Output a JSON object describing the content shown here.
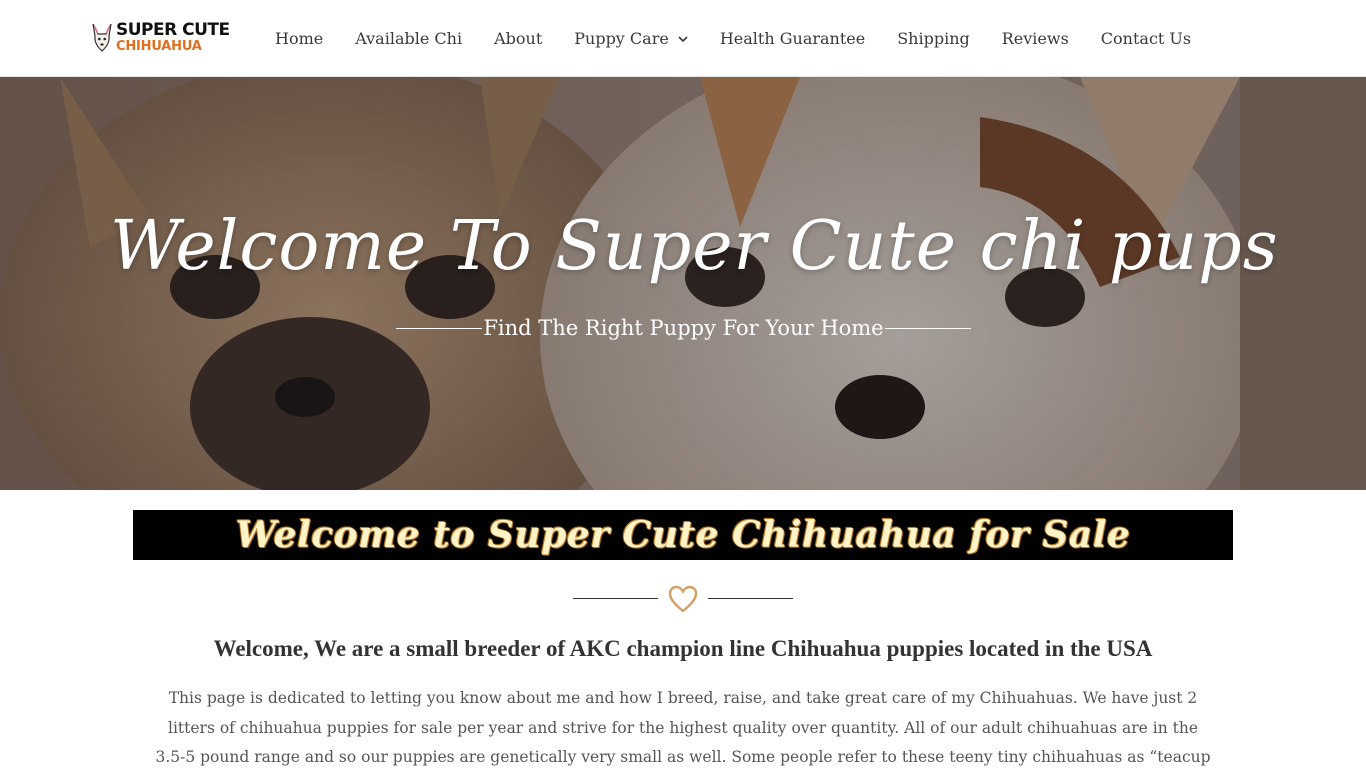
{
  "header": {
    "logo": {
      "line1": "SUPER CUTE",
      "line2": "CHIHUAHUA",
      "icon": "chihuahua-logo-icon",
      "accent": "#e0701f"
    },
    "nav": [
      {
        "label": "Home"
      },
      {
        "label": "Available Chi"
      },
      {
        "label": "About"
      },
      {
        "label": "Puppy Care",
        "dropdown_icon": "chevron-down-icon"
      },
      {
        "label": "Health Guarantee"
      },
      {
        "label": "Shipping"
      },
      {
        "label": "Reviews"
      },
      {
        "label": "Contact Us"
      }
    ]
  },
  "hero": {
    "title": "Welcome To Super Cute chi pups",
    "subtitle": "Find The Right Puppy For Your Home"
  },
  "banner": {
    "text": "Welcome to Super Cute Chihuahua for Sale"
  },
  "divider": {
    "icon": "heart-icon",
    "color": "#d4a06a"
  },
  "content": {
    "heading": "Welcome, We are a small breeder of AKC champion line Chihuahua puppies located in the USA",
    "paragraph": "This page is dedicated to letting you know about me and how I breed, raise, and take great care of my Chihuahuas.  We have just 2 litters of chihuahua puppies for sale per year and strive for the highest quality over quantity.  All of our adult chihuahuas are in the 3.5-5 pound range and so our puppies are genetically very small as well.  Some people refer to these teeny tiny chihuahuas as “teacup chihuahuas”, however this"
  }
}
